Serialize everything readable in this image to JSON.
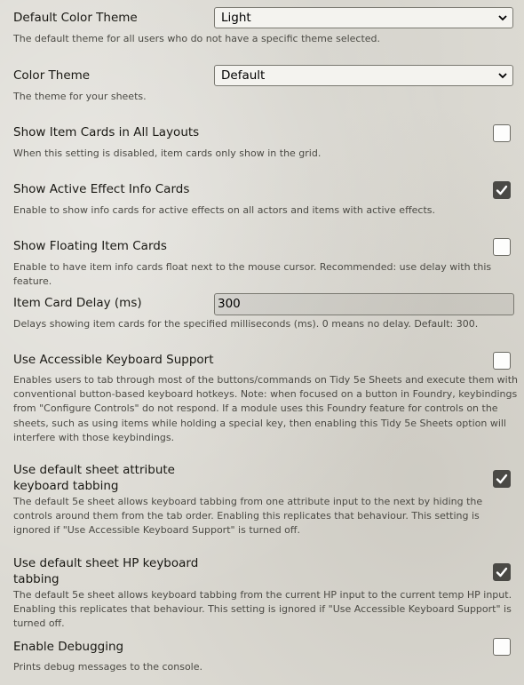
{
  "settings": [
    {
      "label": "Default Color Theme",
      "hint": "The default theme for all users who do not have a specific theme selected.",
      "control": "select",
      "value": "Light"
    },
    {
      "label": "Color Theme",
      "hint": "The theme for your sheets.",
      "control": "select",
      "value": "Default"
    },
    {
      "label": "Show Item Cards in All Layouts",
      "hint": "When this setting is disabled, item cards only show in the grid.",
      "control": "checkbox",
      "checked": false
    },
    {
      "label": "Show Active Effect Info Cards",
      "hint": "Enable to show info cards for active effects on all actors and items with active effects.",
      "control": "checkbox",
      "checked": true
    },
    {
      "label": "Show Floating Item Cards",
      "hint": "Enable to have item info cards float next to the mouse cursor. Recommended: use delay with this feature.",
      "control": "checkbox",
      "checked": false
    },
    {
      "label": "Item Card Delay (ms)",
      "hint": "Delays showing item cards for the specified milliseconds (ms). 0 means no delay. Default: 300.",
      "control": "text",
      "value": "300"
    },
    {
      "label": "Use Accessible Keyboard Support",
      "hint": "Enables users to tab through most of the buttons/commands on Tidy 5e Sheets and execute them with conventional button-based keyboard hotkeys. Note: when focused on a button in Foundry, keybindings from \"Configure Controls\" do not respond. If a module uses this Foundry feature for controls on the sheets, such as using items while holding a special key, then enabling this Tidy 5e Sheets option will interfere with those keybindings.",
      "control": "checkbox",
      "checked": false
    },
    {
      "label": "Use default sheet attribute keyboard tabbing",
      "hint": "The default 5e sheet allows keyboard tabbing from one attribute input to the next by hiding the controls around them from the tab order. Enabling this replicates that behaviour. This setting is ignored if \"Use Accessible Keyboard Support\" is turned off.",
      "control": "checkbox",
      "checked": true
    },
    {
      "label": "Use default sheet HP keyboard tabbing",
      "hint": "The default 5e sheet allows keyboard tabbing from the current HP input to the current temp HP input. Enabling this replicates that behaviour. This setting is ignored if \"Use Accessible Keyboard Support\" is turned off.",
      "control": "checkbox",
      "checked": true
    },
    {
      "label": "Enable Debugging",
      "hint": "Prints debug messages to the console.",
      "control": "checkbox",
      "checked": false
    }
  ]
}
